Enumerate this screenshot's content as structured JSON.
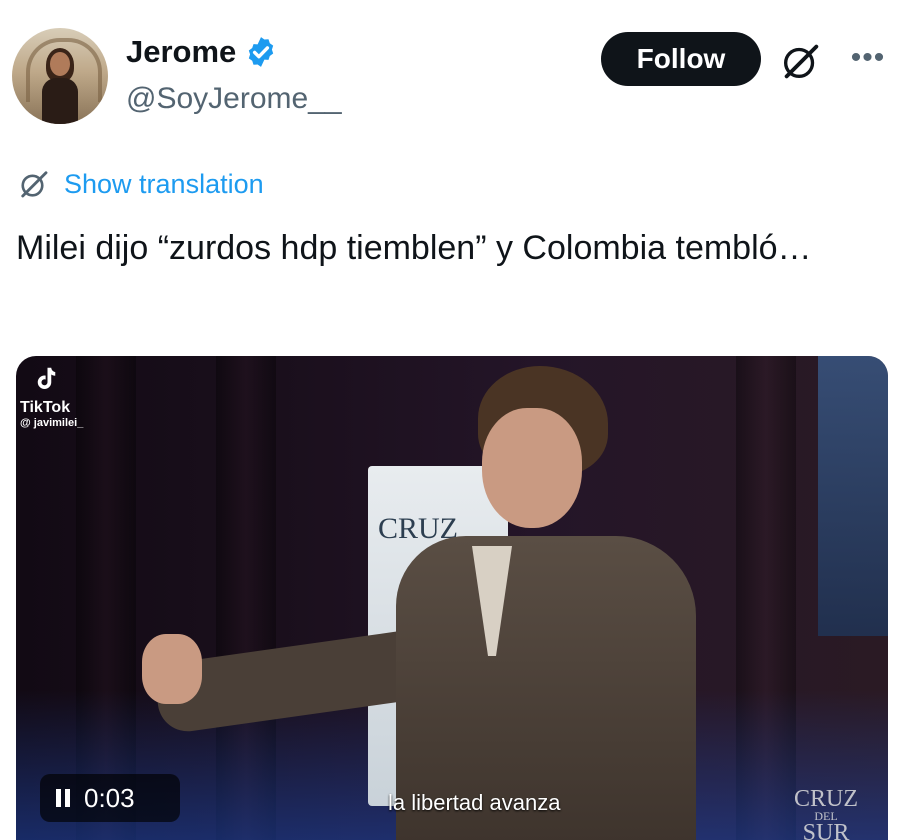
{
  "author": {
    "name": "Jerome",
    "handle": "@SoyJerome__",
    "verified": true
  },
  "header": {
    "follow_label": "Follow",
    "more_label": "•••"
  },
  "translation": {
    "label": "Show translation"
  },
  "tweet": {
    "text": "Milei dijo “zurdos hdp tiemblen” y Colombia tembló…"
  },
  "video": {
    "tiktok_label": "TikTok",
    "tiktok_user": "@ javimilei_",
    "banner_text": "CRUZ",
    "time": "0:03",
    "subtitle": "la libertad avanza",
    "watermark_main": "CRUZ",
    "watermark_sub": "DEL",
    "watermark_tail": "SUR"
  },
  "colors": {
    "accent": "#1d9bf0",
    "follow_bg": "#0f1419",
    "secondary_text": "#536471"
  }
}
